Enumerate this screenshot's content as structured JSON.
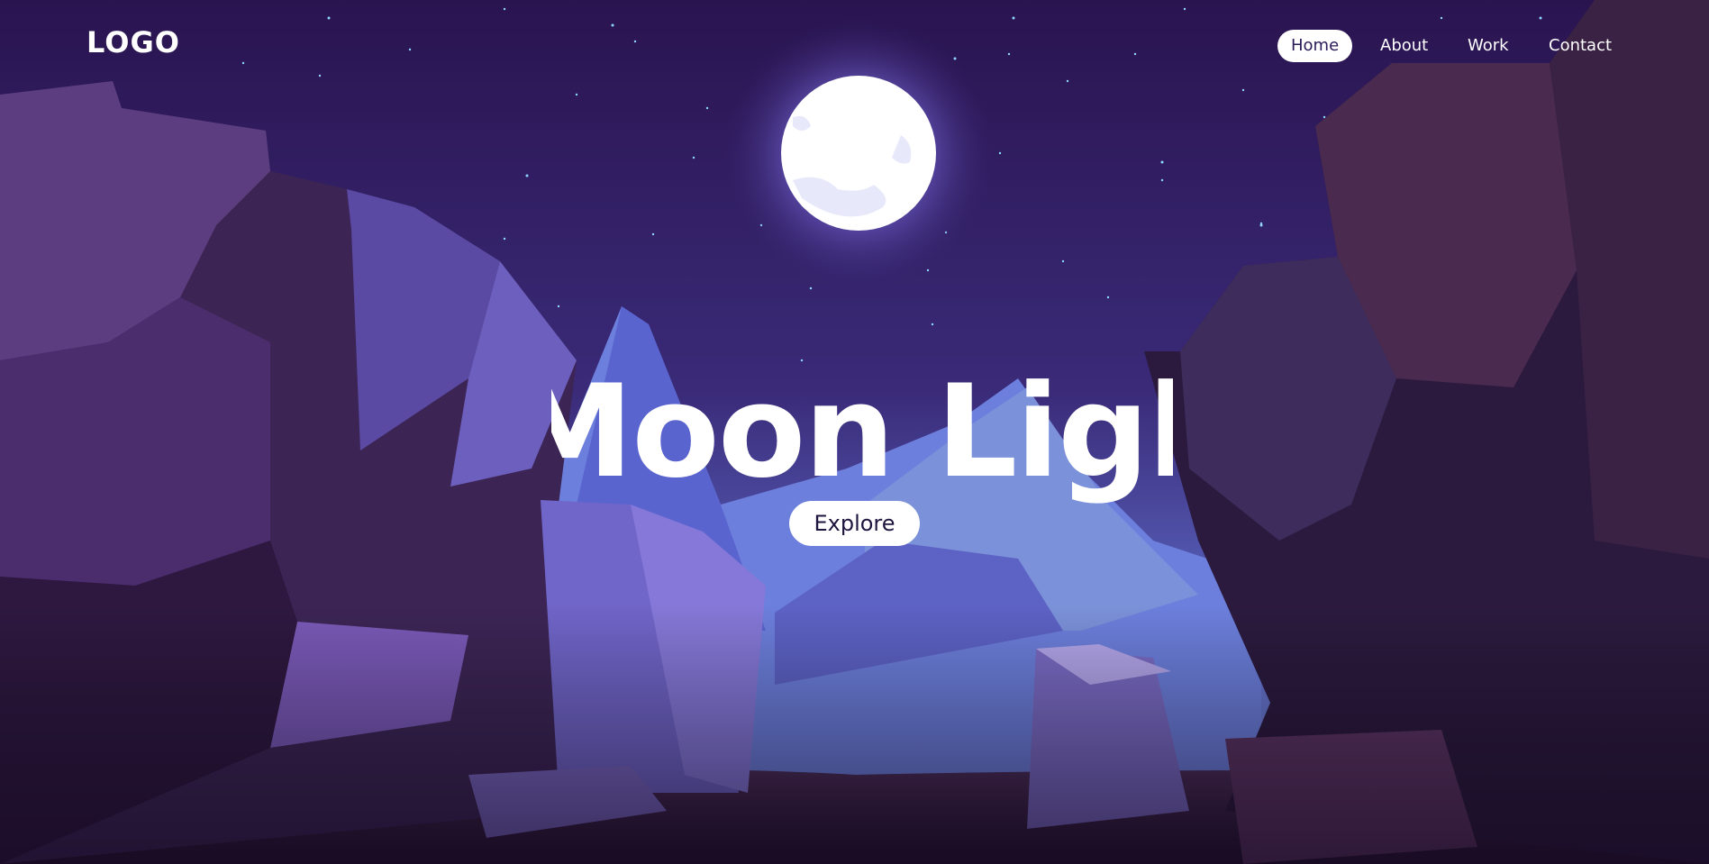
{
  "header": {
    "logo": "LOGO",
    "nav": [
      {
        "label": "Home",
        "active": true
      },
      {
        "label": "About",
        "active": false
      },
      {
        "label": "Work",
        "active": false
      },
      {
        "label": "Contact",
        "active": false
      }
    ]
  },
  "hero": {
    "title": "Moon Light",
    "button_label": "Explore"
  },
  "colors": {
    "sky_top": "#2a1450",
    "sky_mid": "#3a2a78",
    "moon": "#ffffff",
    "moon_glow": "#7d6cf0",
    "rock_dark": "#2b1a3e",
    "rock_mid": "#5a3a8a",
    "rock_light": "#7c6fd6",
    "mountain": "#6e7fd8"
  },
  "background_icons": [
    "moon-icon",
    "stars",
    "canyon-rocks",
    "mountains"
  ]
}
